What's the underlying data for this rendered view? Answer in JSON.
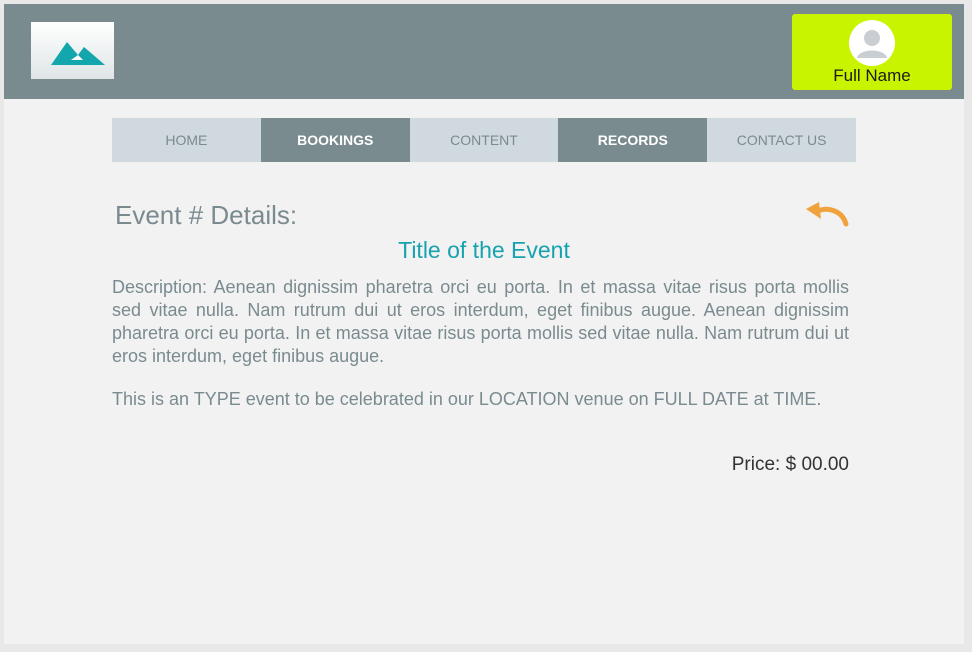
{
  "header": {
    "logo_icon": "mountain-logo-icon",
    "user_icon": "user-avatar-icon",
    "user_name": "Full Name"
  },
  "nav": {
    "items": [
      {
        "label": "HOME",
        "style": "light"
      },
      {
        "label": "BOOKINGS",
        "style": "dark"
      },
      {
        "label": "CONTENT",
        "style": "light"
      },
      {
        "label": "RECORDS",
        "style": "dark"
      },
      {
        "label": "CONTACT US",
        "style": "light"
      }
    ]
  },
  "main": {
    "section_title": "Event # Details:",
    "back_icon": "undo-arrow-icon",
    "event_title": "Title of the Event",
    "description": "Description: Aenean dignissim pharetra orci eu porta. In et massa vitae risus porta mollis sed vitae nulla. Nam rutrum dui ut eros interdum, eget finibus augue. Aenean dignissim pharetra orci eu porta. In et massa vitae risus porta mollis sed vitae nulla. Nam rutrum dui ut eros interdum, eget finibus augue.",
    "event_info": "This is an TYPE event to be celebrated in our LOCATION venue on FULL DATE at TIME.",
    "price": "Price: $ 00.00"
  },
  "colors": {
    "header_bg": "#7a8b90",
    "accent_lime": "#c8f400",
    "accent_teal": "#17a2b0",
    "back_arrow": "#f0a23c",
    "nav_light": "#d0d9de"
  }
}
